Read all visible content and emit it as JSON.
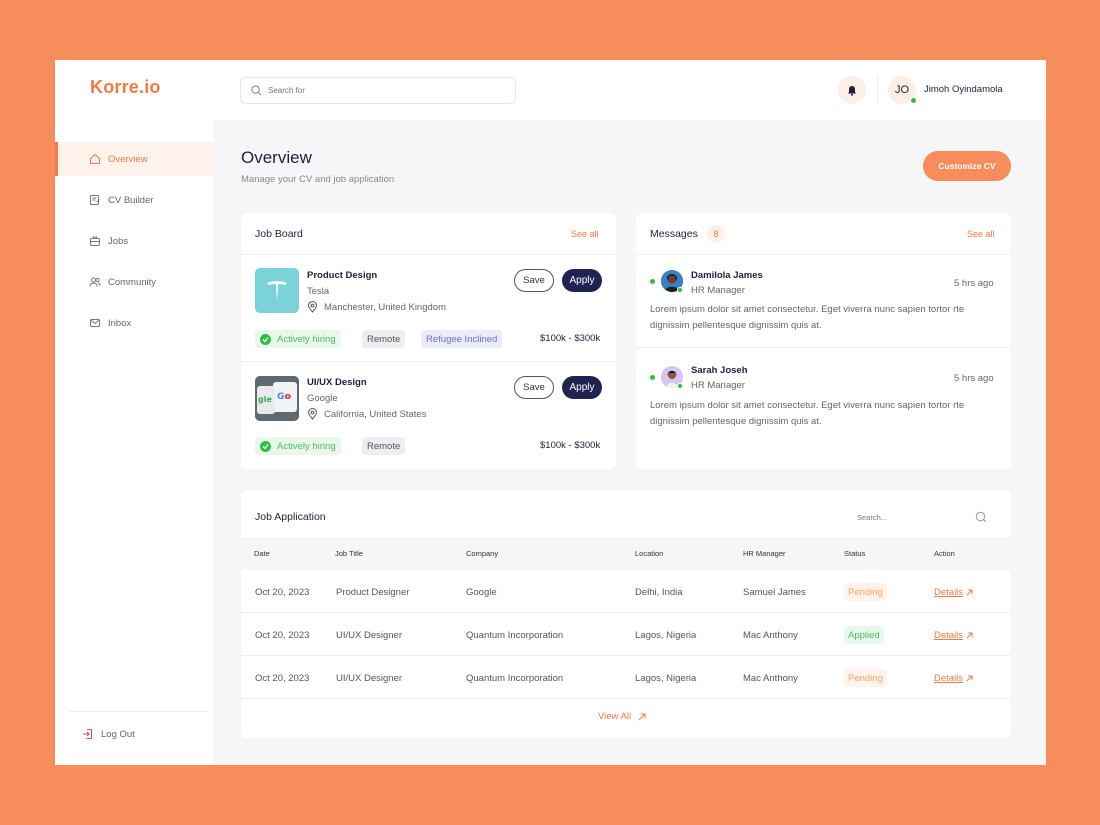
{
  "app": {
    "logo": "Korre.io"
  },
  "topbar": {
    "search_placeholder": "Search for",
    "user_initials": "JO",
    "user_name": "Jimoh Oyindamola"
  },
  "sidebar": {
    "items": [
      {
        "label": "Overview",
        "icon": "home-icon",
        "active": true
      },
      {
        "label": "CV Builder",
        "icon": "document-edit-icon",
        "active": false
      },
      {
        "label": "Jobs",
        "icon": "briefcase-icon",
        "active": false
      },
      {
        "label": "Community",
        "icon": "users-icon",
        "active": false
      },
      {
        "label": "Inbox",
        "icon": "mail-icon",
        "active": false
      }
    ],
    "logout": "Log Out"
  },
  "header": {
    "title": "Overview",
    "subtitle": "Manage your CV and job application",
    "customize_label": "Customize CV"
  },
  "job_board": {
    "title": "Job Board",
    "see_all": "See all",
    "save_label": "Save",
    "apply_label": "Apply",
    "jobs": [
      {
        "title": "Product Design",
        "company": "Tesla",
        "location": "Manchester, United Kingdom",
        "tags": [
          "Actively hiring",
          "Remote",
          "Refugee Inclined"
        ],
        "salary": "$100k - $300k"
      },
      {
        "title": "UI/UX Design",
        "company": "Google",
        "location": "California, United States",
        "tags": [
          "Actively hiring",
          "Remote"
        ],
        "salary": "$100k - $300k"
      }
    ]
  },
  "messages": {
    "title": "Messages",
    "count": "8",
    "see_all": "See all",
    "items": [
      {
        "name": "Damilola James",
        "role": "HR Manager",
        "time": "5 hrs ago",
        "text": "Lorem ipsum dolor sit amet consectetur. Eget viverra nunc sapien tortor rte dignissim pellentesque dignissim quis at."
      },
      {
        "name": "Sarah Joseh",
        "role": "HR Manager",
        "time": "5 hrs ago",
        "text": "Lorem ipsum dolor sit amet consectetur. Eget viverra nunc sapien tortor rte dignissim pellentesque dignissim quis at."
      }
    ]
  },
  "applications": {
    "title": "Job Application",
    "search_placeholder": "Search...",
    "columns": [
      "Date",
      "Job Title",
      "Company",
      "Location",
      "HR Manager",
      "Status",
      "Action"
    ],
    "rows": [
      {
        "date": "Oct 20, 2023",
        "job_title": "Product Designer",
        "company": "Google",
        "location": "Delhi, India",
        "hr_manager": "Samuel James",
        "status": "Pending",
        "action": "Details"
      },
      {
        "date": "Oct 20, 2023",
        "job_title": "UI/UX Designer",
        "company": "Quantum Incorporation",
        "location": "Lagos, Nigeria",
        "hr_manager": "Mac Anthony",
        "status": "Applied",
        "action": "Details"
      },
      {
        "date": "Oct 20, 2023",
        "job_title": "UI/UX Designer",
        "company": "Quantum Incorporation",
        "location": "Lagos, Nigeria",
        "hr_manager": "Mac Anthony",
        "status": "Pending",
        "action": "Details"
      }
    ],
    "view_all": "View All"
  },
  "colors": {
    "accent": "#F07B44",
    "background": "#F78D5B",
    "navy": "#1F2352",
    "success": "#2DBE4A"
  }
}
